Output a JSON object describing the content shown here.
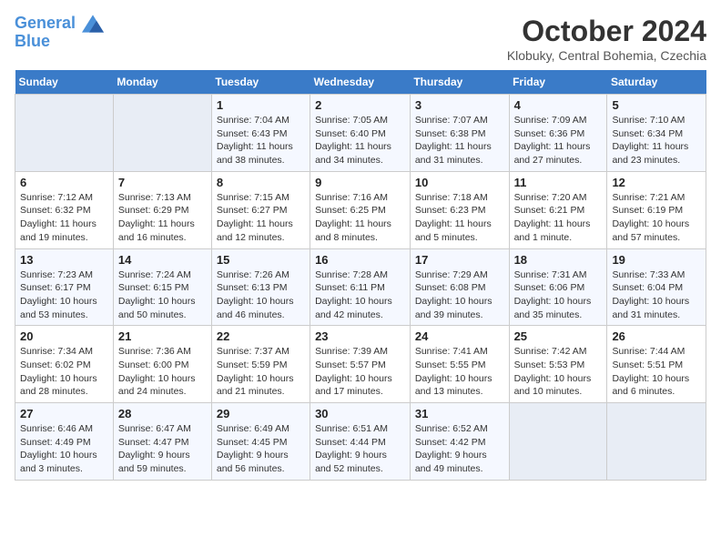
{
  "header": {
    "logo_line1": "General",
    "logo_line2": "Blue",
    "month": "October 2024",
    "location": "Klobuky, Central Bohemia, Czechia"
  },
  "days_of_week": [
    "Sunday",
    "Monday",
    "Tuesday",
    "Wednesday",
    "Thursday",
    "Friday",
    "Saturday"
  ],
  "weeks": [
    [
      {
        "day": "",
        "text": ""
      },
      {
        "day": "",
        "text": ""
      },
      {
        "day": "1",
        "text": "Sunrise: 7:04 AM\nSunset: 6:43 PM\nDaylight: 11 hours and 38 minutes."
      },
      {
        "day": "2",
        "text": "Sunrise: 7:05 AM\nSunset: 6:40 PM\nDaylight: 11 hours and 34 minutes."
      },
      {
        "day": "3",
        "text": "Sunrise: 7:07 AM\nSunset: 6:38 PM\nDaylight: 11 hours and 31 minutes."
      },
      {
        "day": "4",
        "text": "Sunrise: 7:09 AM\nSunset: 6:36 PM\nDaylight: 11 hours and 27 minutes."
      },
      {
        "day": "5",
        "text": "Sunrise: 7:10 AM\nSunset: 6:34 PM\nDaylight: 11 hours and 23 minutes."
      }
    ],
    [
      {
        "day": "6",
        "text": "Sunrise: 7:12 AM\nSunset: 6:32 PM\nDaylight: 11 hours and 19 minutes."
      },
      {
        "day": "7",
        "text": "Sunrise: 7:13 AM\nSunset: 6:29 PM\nDaylight: 11 hours and 16 minutes."
      },
      {
        "day": "8",
        "text": "Sunrise: 7:15 AM\nSunset: 6:27 PM\nDaylight: 11 hours and 12 minutes."
      },
      {
        "day": "9",
        "text": "Sunrise: 7:16 AM\nSunset: 6:25 PM\nDaylight: 11 hours and 8 minutes."
      },
      {
        "day": "10",
        "text": "Sunrise: 7:18 AM\nSunset: 6:23 PM\nDaylight: 11 hours and 5 minutes."
      },
      {
        "day": "11",
        "text": "Sunrise: 7:20 AM\nSunset: 6:21 PM\nDaylight: 11 hours and 1 minute."
      },
      {
        "day": "12",
        "text": "Sunrise: 7:21 AM\nSunset: 6:19 PM\nDaylight: 10 hours and 57 minutes."
      }
    ],
    [
      {
        "day": "13",
        "text": "Sunrise: 7:23 AM\nSunset: 6:17 PM\nDaylight: 10 hours and 53 minutes."
      },
      {
        "day": "14",
        "text": "Sunrise: 7:24 AM\nSunset: 6:15 PM\nDaylight: 10 hours and 50 minutes."
      },
      {
        "day": "15",
        "text": "Sunrise: 7:26 AM\nSunset: 6:13 PM\nDaylight: 10 hours and 46 minutes."
      },
      {
        "day": "16",
        "text": "Sunrise: 7:28 AM\nSunset: 6:11 PM\nDaylight: 10 hours and 42 minutes."
      },
      {
        "day": "17",
        "text": "Sunrise: 7:29 AM\nSunset: 6:08 PM\nDaylight: 10 hours and 39 minutes."
      },
      {
        "day": "18",
        "text": "Sunrise: 7:31 AM\nSunset: 6:06 PM\nDaylight: 10 hours and 35 minutes."
      },
      {
        "day": "19",
        "text": "Sunrise: 7:33 AM\nSunset: 6:04 PM\nDaylight: 10 hours and 31 minutes."
      }
    ],
    [
      {
        "day": "20",
        "text": "Sunrise: 7:34 AM\nSunset: 6:02 PM\nDaylight: 10 hours and 28 minutes."
      },
      {
        "day": "21",
        "text": "Sunrise: 7:36 AM\nSunset: 6:00 PM\nDaylight: 10 hours and 24 minutes."
      },
      {
        "day": "22",
        "text": "Sunrise: 7:37 AM\nSunset: 5:59 PM\nDaylight: 10 hours and 21 minutes."
      },
      {
        "day": "23",
        "text": "Sunrise: 7:39 AM\nSunset: 5:57 PM\nDaylight: 10 hours and 17 minutes."
      },
      {
        "day": "24",
        "text": "Sunrise: 7:41 AM\nSunset: 5:55 PM\nDaylight: 10 hours and 13 minutes."
      },
      {
        "day": "25",
        "text": "Sunrise: 7:42 AM\nSunset: 5:53 PM\nDaylight: 10 hours and 10 minutes."
      },
      {
        "day": "26",
        "text": "Sunrise: 7:44 AM\nSunset: 5:51 PM\nDaylight: 10 hours and 6 minutes."
      }
    ],
    [
      {
        "day": "27",
        "text": "Sunrise: 6:46 AM\nSunset: 4:49 PM\nDaylight: 10 hours and 3 minutes."
      },
      {
        "day": "28",
        "text": "Sunrise: 6:47 AM\nSunset: 4:47 PM\nDaylight: 9 hours and 59 minutes."
      },
      {
        "day": "29",
        "text": "Sunrise: 6:49 AM\nSunset: 4:45 PM\nDaylight: 9 hours and 56 minutes."
      },
      {
        "day": "30",
        "text": "Sunrise: 6:51 AM\nSunset: 4:44 PM\nDaylight: 9 hours and 52 minutes."
      },
      {
        "day": "31",
        "text": "Sunrise: 6:52 AM\nSunset: 4:42 PM\nDaylight: 9 hours and 49 minutes."
      },
      {
        "day": "",
        "text": ""
      },
      {
        "day": "",
        "text": ""
      }
    ]
  ]
}
